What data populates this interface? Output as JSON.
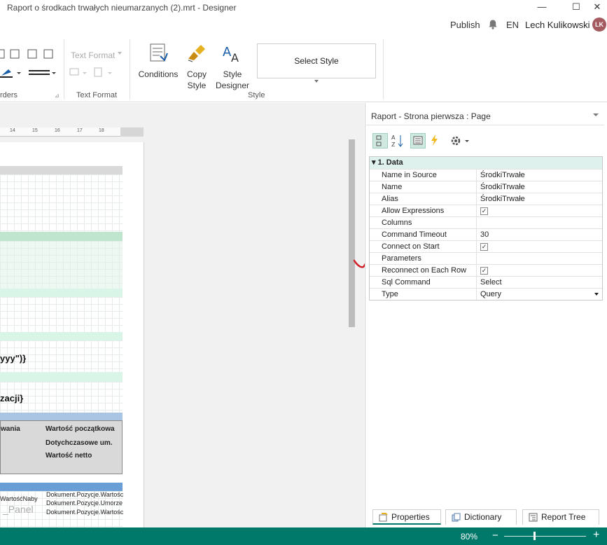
{
  "window": {
    "title": "Raport o środkach trwałych nieumarzanych (2).mrt - Designer",
    "minimize": "—",
    "maximize": "☐",
    "close": "✕"
  },
  "user_bar": {
    "publish": "Publish",
    "language": "EN",
    "user_name": "Lech Kulikowski",
    "avatar_initials": "LK"
  },
  "ribbon": {
    "borders_group": "rders",
    "text_format_group": "Text Format",
    "text_format_dropdown": "Text Format",
    "style_group": "Style",
    "conditions": "Conditions",
    "copy_style_1": "Copy",
    "copy_style_2": "Style",
    "style_designer_1": "Style",
    "style_designer_2": "Designer",
    "select_style": "Select Style"
  },
  "ruler": {
    "ticks": [
      "15",
      "16",
      "17",
      "18"
    ],
    "first_tick": "14"
  },
  "canvas": {
    "text_1": "yyy\")}",
    "text_2": "zacji}",
    "header_col1": "wania",
    "header_col2_line1": "Wartość początkowa",
    "header_col2_line2": "Dotychczasowe um.",
    "header_col2_line3": "Wartość netto",
    "data_col1": "WartośćNaby",
    "data_col2_line1": "Dokument.Pozycje.Wartośc",
    "data_col2_line2": "Dokument.Pozycje.Umorze",
    "data_col2_line3": "Dokument.Pozycje.Wartośc",
    "panel_label": "_Panel"
  },
  "properties_panel": {
    "title": "Raport - Strona pierwsza : Page",
    "category": "1. Data",
    "rows": [
      {
        "name": "Name in Source",
        "value": "ŚrodkiTrwałe"
      },
      {
        "name": "Name",
        "value": "ŚrodkiTrwałe"
      },
      {
        "name": "Alias",
        "value": "ŚrodkiTrwałe"
      },
      {
        "name": "Allow Expressions",
        "value": ""
      },
      {
        "name": "Columns",
        "value": ""
      },
      {
        "name": "Command Timeout",
        "value": "30"
      },
      {
        "name": "Connect on Start",
        "value": ""
      },
      {
        "name": "Parameters",
        "value": ""
      },
      {
        "name": "Reconnect on Each Row",
        "value": ""
      },
      {
        "name": "Sql Command",
        "value": "Select"
      },
      {
        "name": "Type",
        "value": "Query"
      }
    ],
    "tabs": {
      "properties": "Properties",
      "dictionary": "Dictionary",
      "report_tree": "Report Tree"
    }
  },
  "status_bar": {
    "zoom": "80%",
    "zoom_minus": "−",
    "zoom_plus": "+"
  },
  "colors": {
    "accent": "#00796b",
    "annotation": "#d0202a"
  }
}
